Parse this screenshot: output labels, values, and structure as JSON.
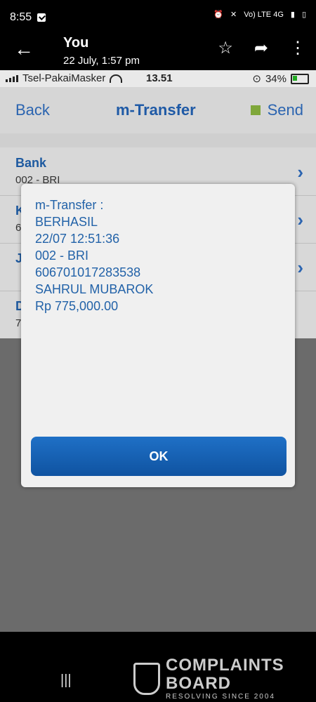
{
  "android_status": {
    "time": "8:55",
    "network": "Vo) LTE 4G"
  },
  "top_bar": {
    "title": "You",
    "subtitle": "22 July, 1:57 pm"
  },
  "photo": {
    "ios_status": {
      "carrier": "Tsel-PakaiMasker",
      "time": "13.51",
      "battery": "34%"
    },
    "app_nav": {
      "back_label": "Back",
      "title": "m-Transfer",
      "send_label": "Send"
    },
    "list": [
      {
        "title": "Bank",
        "value": "002 - BRI"
      },
      {
        "title": "K",
        "value": "6"
      },
      {
        "title": "J",
        "value": ""
      },
      {
        "title": "D",
        "value": "7"
      }
    ],
    "dialog": {
      "lines": [
        "m-Transfer :",
        "BERHASIL",
        "22/07 12:51:36",
        "002 - BRI",
        "606701017283538",
        "SAHRUL MUBAROK",
        "Rp 775,000.00"
      ],
      "ok_label": "OK"
    }
  },
  "watermark": {
    "line1": "COMPLAINTS",
    "line2": "BOARD",
    "line3": "RESOLVING SINCE 2004"
  },
  "colors": {
    "accent": "#2262a8",
    "ok_button": "#1463b4",
    "send_indicator": "#7fa73a"
  }
}
